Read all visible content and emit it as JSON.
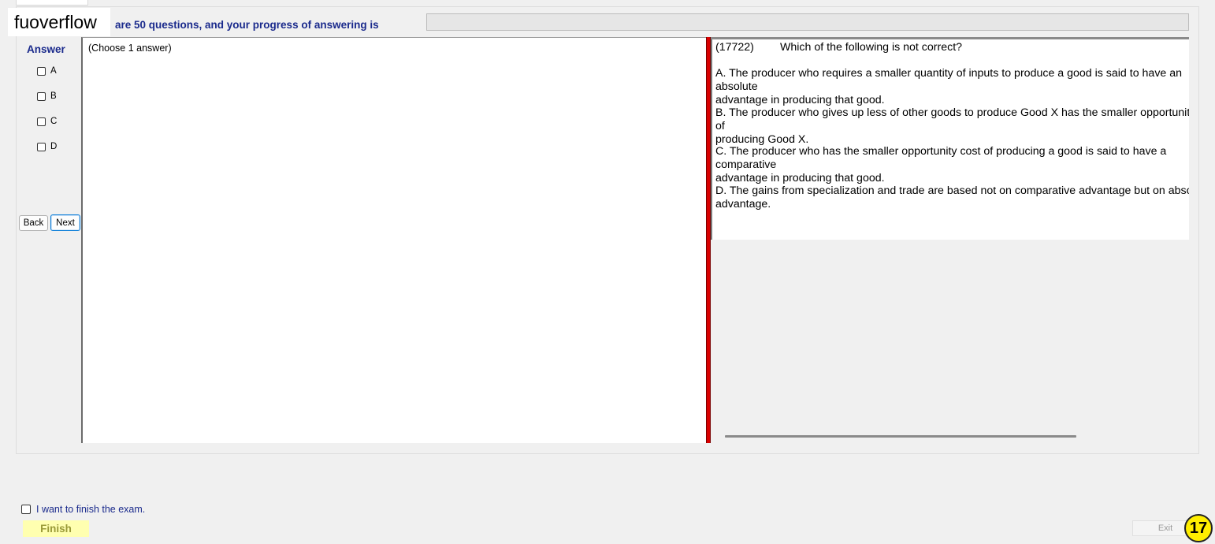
{
  "app": {
    "brand": "fuoverflow"
  },
  "progress": {
    "text": "are 50 questions, and your progress of answering is",
    "percent": 0
  },
  "answer": {
    "label": "Answer",
    "options": [
      "A",
      "B",
      "C",
      "D"
    ],
    "hint": "(Choose 1 answer)"
  },
  "nav": {
    "back_label": "Back",
    "next_label": "Next"
  },
  "question": {
    "id": "(17722)",
    "prompt": "Which of the following is not correct?",
    "options": [
      {
        "line1": "A.  The producer who requires a smaller quantity of inputs to produce a good is said to have an absolute",
        "line2": "advantage in producing that good."
      },
      {
        "line1": "B.  The producer who gives up less of other goods to produce Good X has the smaller opportunity cost of",
        "line2": "producing Good X."
      },
      {
        "line1": "C.  The producer who has the smaller opportunity cost of producing a good is said to have a comparative",
        "line2": "advantage in producing that good."
      },
      {
        "line1": "D.  The gains from specialization and trade are based not on comparative advantage but on absolute",
        "line2": "advantage."
      }
    ]
  },
  "footer": {
    "finish_check_label": "I want to finish the exam.",
    "finish_label": "Finish",
    "exit_label": "Exit",
    "page_number": "17"
  },
  "colors": {
    "accent_text": "#1a2a8c",
    "splitter": "#d90000",
    "finish_bg": "#ffffb0",
    "badge": "#ffee00"
  }
}
